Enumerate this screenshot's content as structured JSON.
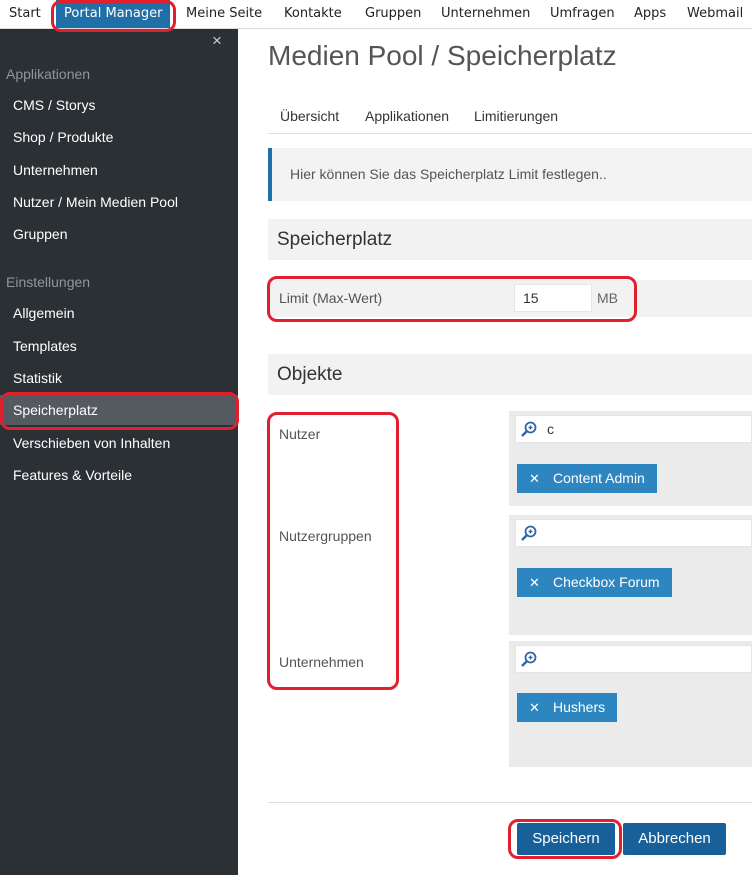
{
  "topnav": {
    "items": [
      "Start",
      "Portal Manager",
      "Meine Seite",
      "Kontakte",
      "Gruppen",
      "Unternehmen",
      "Umfragen",
      "Apps",
      "Webmail"
    ]
  },
  "sidebar": {
    "close_glyph": "×",
    "sections": [
      "Applikationen",
      "Einstellungen"
    ],
    "app_links": [
      "CMS / Storys",
      "Shop / Produkte",
      "Unternehmen",
      "Nutzer / Mein Medien Pool",
      "Gruppen"
    ],
    "settings_links": [
      "Allgemein",
      "Templates",
      "Statistik",
      "Speicherplatz",
      "Verschieben von Inhalten",
      "Features & Vorteile"
    ]
  },
  "main": {
    "title": "Medien Pool / Speicherplatz",
    "tabs": [
      "Übersicht",
      "Applikationen",
      "Limitierungen"
    ],
    "info": "Hier können Sie das Speicherplatz Limit festlegen..",
    "storage": {
      "heading": "Speicherplatz",
      "limit_label": "Limit (Max-Wert)",
      "limit_value": "15",
      "unit": "MB"
    },
    "objects": {
      "heading": "Objekte",
      "users": {
        "label": "Nutzer",
        "query": "c",
        "tags": [
          "Content Admin"
        ]
      },
      "groups": {
        "label": "Nutzergruppen",
        "query": "",
        "tags": [
          "Checkbox Forum"
        ]
      },
      "companies": {
        "label": "Unternehmen",
        "query": "",
        "tags": [
          "Hushers"
        ]
      }
    },
    "buttons": {
      "save": "Speichern",
      "cancel": "Abbrechen"
    }
  },
  "colors": {
    "accent": "#1f6fa8",
    "sidebar": "#2b3035",
    "tag": "#2e86c1",
    "highlight": "#e0202e"
  },
  "icons": {
    "search": "magnifier-plus-icon",
    "remove": "close-icon"
  }
}
